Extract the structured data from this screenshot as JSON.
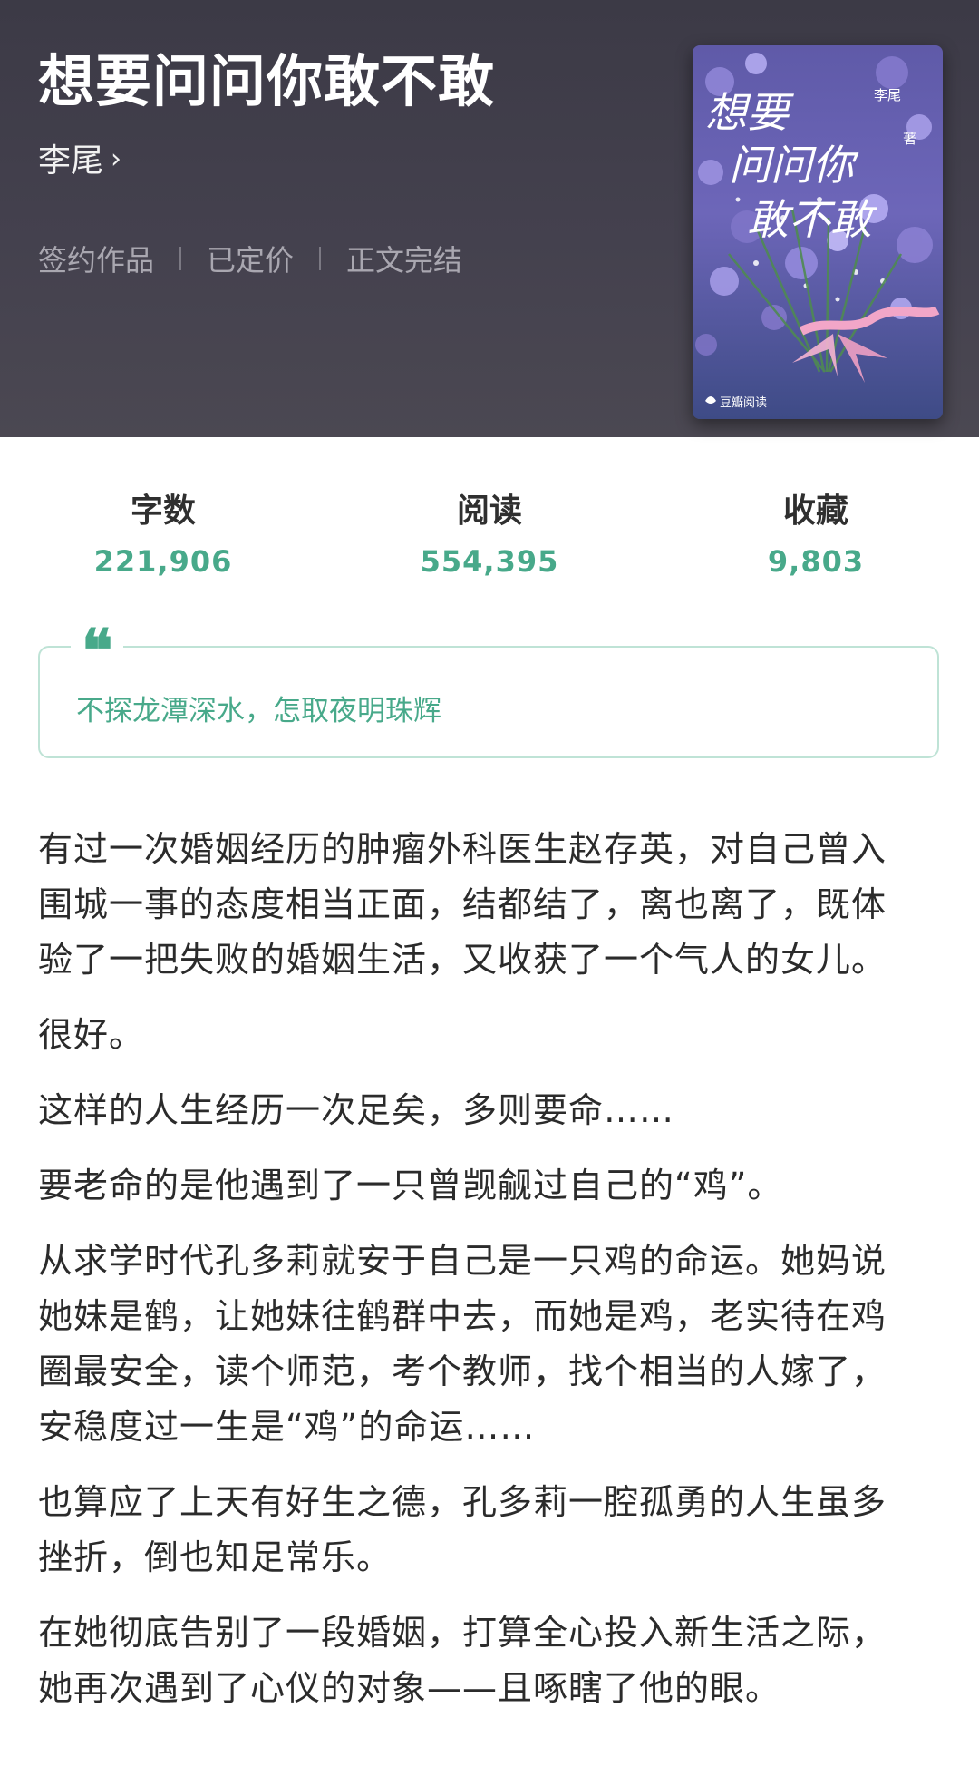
{
  "book": {
    "title": "想要问问你敢不敢",
    "author": "李尾",
    "author_chevron": "›",
    "tags": [
      "签约作品",
      "已定价",
      "正文完结"
    ],
    "cover": {
      "title_lines": [
        "想要",
        "问问你",
        "敢不敢"
      ],
      "author": "李尾",
      "author_suffix": "著",
      "publisher": "豆瓣阅读"
    }
  },
  "stats": [
    {
      "label": "字数",
      "value": "221,906"
    },
    {
      "label": "阅读",
      "value": "554,395"
    },
    {
      "label": "收藏",
      "value": "9,803"
    }
  ],
  "quote": {
    "mark": "❝",
    "text": "不探龙潭深水，怎取夜明珠辉"
  },
  "synopsis": [
    [
      "有过一次婚姻经历的肿瘤外科医生赵存英，对自己曾入",
      "围城一事的态度相当正面，结都结了，离也离了，既体",
      "验了一把失败的婚姻生活，又收获了一个气人的女儿。"
    ],
    [
      "很好。"
    ],
    [
      "这样的人生经历一次足矣，多则要命……"
    ],
    [
      "要老命的是他遇到了一只曾觊觎过自己的“鸡”。"
    ],
    [
      "从求学时代孔多莉就安于自己是一只鸡的命运。她妈说",
      "她妹是鹤，让她妹往鹤群中去，而她是鸡，老实待在鸡",
      "圈最安全，读个师范，考个教师，找个相当的人嫁了，",
      "安稳度过一生是“鸡”的命运……"
    ],
    [
      "也算应了上天有好生之德，孔多莉一腔孤勇的人生虽多",
      "挫折，倒也知足常乐。"
    ],
    [
      "在她彻底告别了一段婚姻，打算全心投入新生活之际，",
      "她再次遇到了心仪的对象——且啄瞎了他的眼。"
    ]
  ],
  "colors": {
    "header_bg": "#403d49",
    "accent_green": "#48a98a",
    "quote_border": "#bfe3d6"
  }
}
